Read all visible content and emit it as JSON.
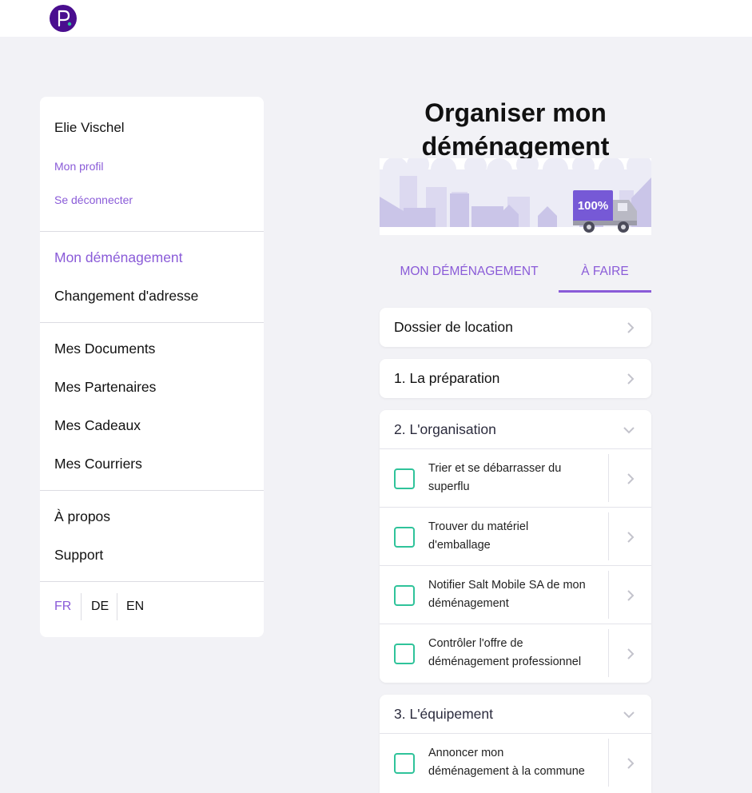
{
  "app": {
    "logo_icon": "p-logo-icon",
    "accent": "#8a5bd8",
    "logo_color": "#4a0e8f",
    "check_color": "#2fc39a"
  },
  "sidebar": {
    "user_name": "Elie Vischel",
    "profile_link": "Mon profil",
    "logout_link": "Se déconnecter",
    "group1": [
      {
        "label": "Mon déménagement",
        "active": true
      },
      {
        "label": "Changement d'adresse",
        "active": false
      }
    ],
    "group2": [
      {
        "label": "Mes Documents"
      },
      {
        "label": "Mes Partenaires"
      },
      {
        "label": "Mes Cadeaux"
      },
      {
        "label": "Mes Courriers"
      }
    ],
    "group3": [
      {
        "label": "À propos"
      },
      {
        "label": "Support"
      }
    ],
    "languages": [
      {
        "code": "FR",
        "active": true
      },
      {
        "code": "DE",
        "active": false
      },
      {
        "code": "EN",
        "active": false
      }
    ]
  },
  "main": {
    "title_line1": "Organiser mon",
    "title_line2": "déménagement",
    "hero": {
      "badge": "100%",
      "illustration_icon": "moving-truck-icon"
    },
    "tabs": [
      {
        "label": "MON DÉMÉNAGEMENT",
        "active": false
      },
      {
        "label": "À FAIRE",
        "active": true
      }
    ],
    "sections": [
      {
        "title": "Dossier de location",
        "expanded": false,
        "icon": "chevron-right-icon"
      },
      {
        "title": "1. La préparation",
        "expanded": false,
        "icon": "chevron-right-icon"
      },
      {
        "title": "2. L'organisation",
        "expanded": true,
        "icon": "chevron-down-icon",
        "tasks": [
          {
            "line1": "Trier et se débarrasser du",
            "line2": "superflu",
            "checked": false
          },
          {
            "line1": "Trouver du matériel",
            "line2": "d'emballage",
            "checked": false
          },
          {
            "line1": "Notifier Salt Mobile SA de mon",
            "line2": "déménagement",
            "checked": false
          },
          {
            "line1": "Contrôler l'offre de",
            "line2": "déménagement professionnel",
            "checked": false
          }
        ]
      },
      {
        "title": "3. L'équipement",
        "expanded": true,
        "icon": "chevron-down-icon",
        "tasks": [
          {
            "line1": "Annoncer mon",
            "line2": "déménagement à la commune",
            "checked": false
          }
        ]
      }
    ]
  }
}
